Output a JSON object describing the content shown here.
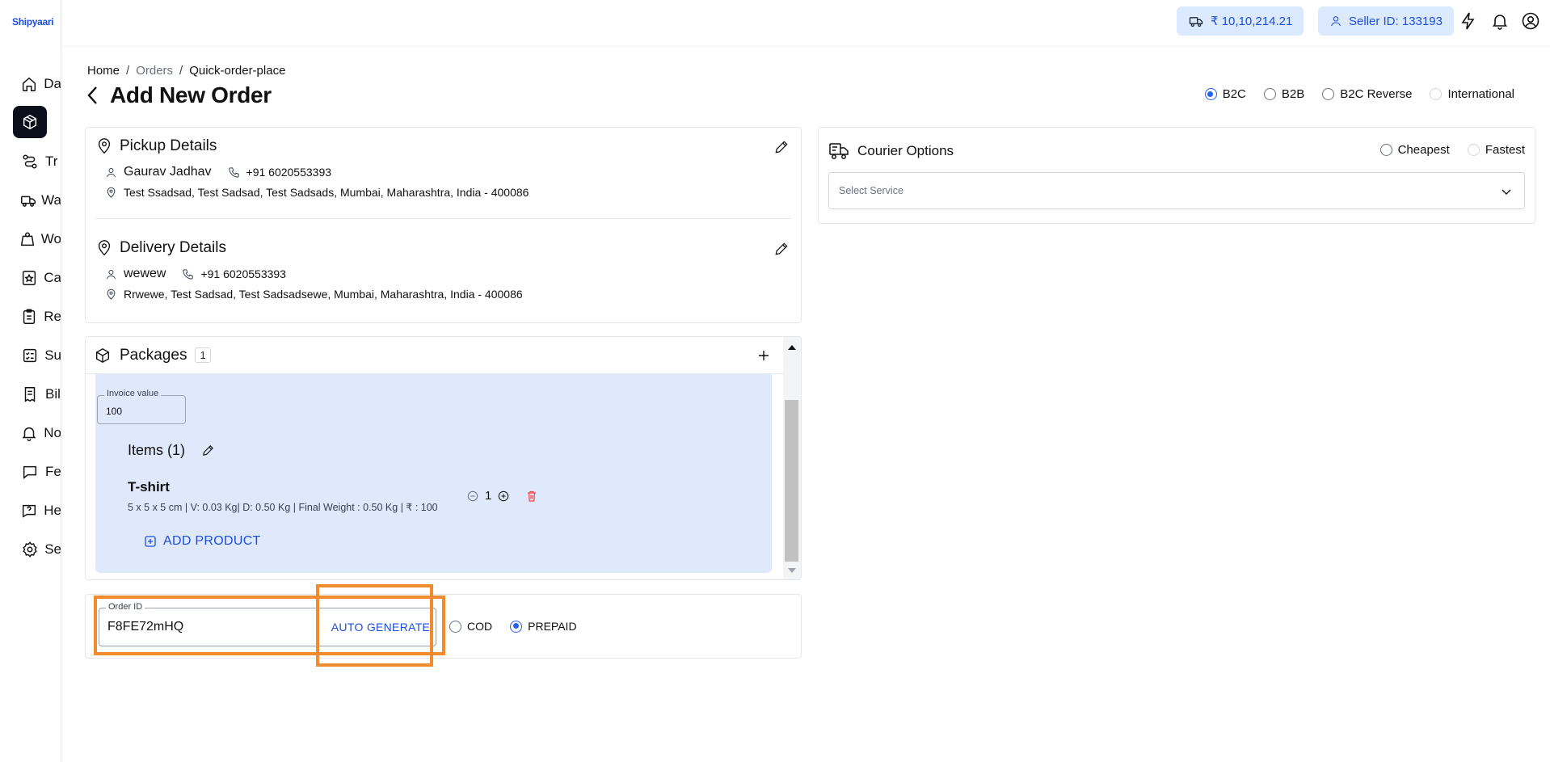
{
  "brand": {
    "logo_text": "Shipyaari",
    "accent": "#1d4ed8",
    "highlight": "#f28a2e"
  },
  "sidebar": {
    "items": [
      {
        "label": "Da",
        "icon": "home-icon"
      },
      {
        "label": "",
        "icon": "box-icon",
        "active": true
      },
      {
        "label": "Tr",
        "icon": "route-icon"
      },
      {
        "label": "Wa",
        "icon": "truck-icon"
      },
      {
        "label": "Wo",
        "icon": "weight-icon"
      },
      {
        "label": "Ca",
        "icon": "badge-icon"
      },
      {
        "label": "Re",
        "icon": "clipboard-icon"
      },
      {
        "label": "Su",
        "icon": "checklist-icon"
      },
      {
        "label": "Bil",
        "icon": "receipt-icon"
      },
      {
        "label": "No",
        "icon": "bell-icon"
      },
      {
        "label": "Fe",
        "icon": "feedback-icon"
      },
      {
        "label": "He",
        "icon": "help-icon"
      },
      {
        "label": "Se",
        "icon": "settings-icon"
      }
    ]
  },
  "topbar": {
    "wallet": "₹ 10,10,214.21",
    "seller": "Seller ID: 133193"
  },
  "breadcrumb": {
    "home": "Home",
    "sep": "/",
    "orders": "Orders",
    "current": "Quick-order-place"
  },
  "page": {
    "title": "Add New Order"
  },
  "order_types": {
    "b2c": "B2C",
    "b2b": "B2B",
    "b2c_reverse": "B2C Reverse",
    "international": "International",
    "selected": "B2C"
  },
  "pickup": {
    "title": "Pickup Details",
    "name": "Gaurav Jadhav",
    "phone": "+91 6020553393",
    "address": "Test Ssadsad, Test Sadsad, Test Sadsads, Mumbai, Maharashtra, India - 400086"
  },
  "delivery": {
    "title": "Delivery Details",
    "name": "wewew",
    "phone": "+91 6020553393",
    "address": "Rrwewe, Test Sadsad, Test Sadsadsewe, Mumbai, Maharashtra, India - 400086"
  },
  "packages": {
    "title": "Packages",
    "count": "1",
    "invoice_label": "Invoice value",
    "invoice_value": "100",
    "items_title": "Items (1)",
    "item": {
      "name": "T-shirt",
      "meta": "5 x 5 x 5 cm | V: 0.03 Kg| D: 0.50 Kg | Final Weight : 0.50 Kg | ₹ : 100",
      "qty": "1"
    },
    "add_product": "ADD PRODUCT"
  },
  "order": {
    "id_label": "Order ID",
    "id_value": "F8FE72mHQ",
    "auto_generate": "AUTO GENERATE",
    "cod": "COD",
    "prepaid": "PREPAID",
    "selected_payment": "PREPAID"
  },
  "courier": {
    "title": "Courier Options",
    "cheapest": "Cheapest",
    "fastest": "Fastest",
    "select_placeholder": "Select Service"
  }
}
